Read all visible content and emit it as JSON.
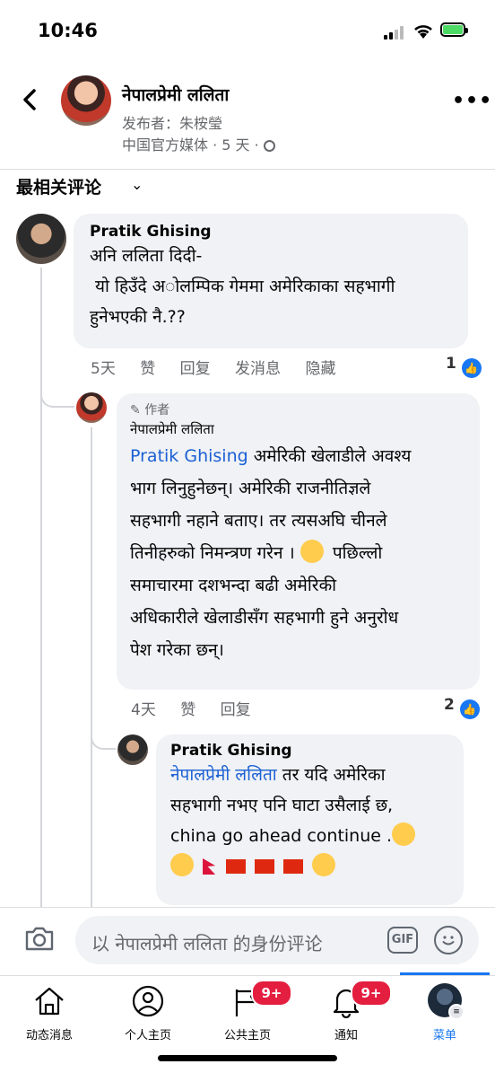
{
  "status_bar": {
    "time": "10:46"
  },
  "header": {
    "name": "नेपालप्रेमी ललिता",
    "publisher": "发布者：朱桉瑩",
    "meta": "中国官方媒体 · 5 天 ·"
  },
  "sort": {
    "label": "最相关评论"
  },
  "comments": [
    {
      "author": "Pratik Ghising",
      "lines": [
        "अनि ललिता दिदी-",
        " यो हिउँदे अ◌ोलम्पिक गेममा अमेरिकाका सहभागी",
        "हुनेभएकी नै.??"
      ],
      "actions": {
        "time": "5天",
        "like": "赞",
        "reply": "回复",
        "message": "发消息",
        "hide": "隐藏"
      },
      "like_count": "1"
    },
    {
      "badge": "作者",
      "author": "नेपालप्रेमी ललिता",
      "mention": "Pratik Ghising",
      "lines": [
        " अमेरिकी खेलाडीले अवश्य",
        "भाग लिनुहुनेछन्। अमेरिकी राजनीतिज्ञले",
        "सहभागी नहाने बताए। तर  त्यसअघि चीनले",
        "तिनीहरुको निमन्त्रण गरेन । ",
        " पछिल्लो",
        "समाचारमा दशभन्दा बढी अमेरिकी",
        "अधिकारीले खेलाडीसँग सहभागी हुने अनुरोध",
        "पेश गरेका छन्।"
      ],
      "actions": {
        "time": "4天",
        "like": "赞",
        "reply": "回复"
      },
      "like_count": "2"
    },
    {
      "author": "Pratik Ghising",
      "mention": "नेपालप्रेमी ललिता",
      "lines": [
        " तर यदि अमेरिका",
        "सहभागी नभए पनि घाटा उसैलाई छ,",
        "china go ahead continue ."
      ]
    }
  ],
  "composer": {
    "placeholder": "以 नेपालप्रेमी ललिता 的身份评论",
    "gif": "GIF"
  },
  "nav": {
    "items": [
      {
        "label": "动态消息"
      },
      {
        "label": "个人主页"
      },
      {
        "label": "公共主页",
        "badge": "9+"
      },
      {
        "label": "通知",
        "badge": "9+"
      },
      {
        "label": "菜单"
      }
    ]
  },
  "colors": {
    "accent": "#1877f2",
    "badge": "#e41e3f",
    "bubble": "#f0f2f5"
  }
}
